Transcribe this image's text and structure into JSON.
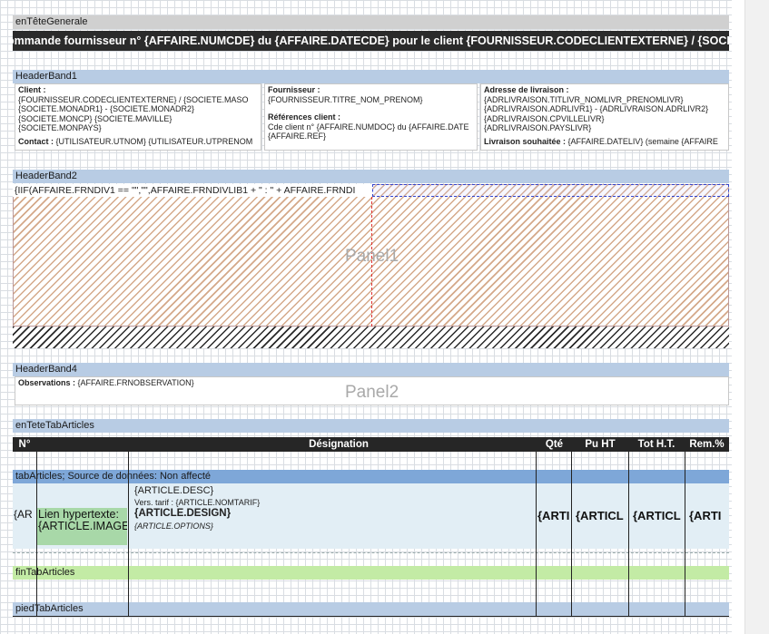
{
  "bands": {
    "entete_generale": "enTêteGenerale",
    "header_band1": "HeaderBand1",
    "header_band2": "HeaderBand2",
    "header_band4": "HeaderBand4",
    "entete_tab_articles": "enTeteTabArticles",
    "tab_articles": "tabArticles; Source de données: Non affecté",
    "fin_tab_articles": "finTabArticles",
    "pied_tab_articles": "piedTabArticles"
  },
  "title_line": "ommande fournisseur n° {AFFAIRE.NUMCDE} du {AFFAIRE.DATECDE} pour le client {FOURNISSEUR.CODECLIENTEXTERNE} / {SOCIETE",
  "client_box": {
    "label": "Client :",
    "lines": [
      "{FOURNISSEUR.CODECLIENTEXTERNE} / {SOCIETE.MASO",
      "{SOCIETE.MONADR1} - {SOCIETE.MONADR2}",
      "{SOCIETE.MONCP} {SOCIETE.MAVILLE}",
      "{SOCIETE.MONPAYS}"
    ],
    "contact_label": "Contact :",
    "contact_value": "{UTILISATEUR.UTNOM} {UTILISATEUR.UTPRENOM"
  },
  "fournisseur_box": {
    "label": "Fournisseur :",
    "value": "{FOURNISSEUR.TITRE_NOM_PRENOM}",
    "ref_label": "Références client :",
    "ref_line1": "Cde client n° {AFFAIRE.NUMDOC} du {AFFAIRE.DATE",
    "ref_line2": "{AFFAIRE.REF}"
  },
  "livraison_box": {
    "label": "Adresse de livraison :",
    "lines": [
      "{ADRLIVRAISON.TITLIVR_NOMLIVR_PRENOMLIVR}",
      "{ADRLIVRAISON.ADRLIVR1} - {ADRLIVRAISON.ADRLIVR2}",
      "{ADRLIVRAISON.CPVILLELIVR}",
      "{ADRLIVRAISON.PAYSLIVR}"
    ],
    "souhaitee_label": "Livraison souhaitée :",
    "souhaitee_value": "{AFFAIRE.DATELIV} (semaine {AFFAIRE"
  },
  "header_band2_expr": "{IIF(AFFAIRE.FRNDIV1 == \"\",\"\",AFFAIRE.FRNDIVLIB1 + \" : \" + AFFAIRE.FRNDI",
  "panel1_label": "Panel1",
  "panel2_label": "Panel2",
  "observations_label": "Observations :",
  "observations_value": "{AFFAIRE.FRNOBSERVATION}",
  "table_headers": [
    "N°",
    "Désignation",
    "Qté",
    "Pu HT",
    "Tot H.T.",
    "Rem.%"
  ],
  "row": {
    "num": "{AR",
    "link_text": "Lien hypertexte: {ARTICLE.IMAGE}",
    "desc": "{ARTICLE.DESC}",
    "tarif": "Vers. tarif : {ARTICLE.NOMTARIF}",
    "design": "{ARTICLE.DESIGN}",
    "options": "{ARTICLE.OPTIONS}",
    "qte": "{ARTI",
    "pu": "{ARTICL",
    "tot": "{ARTICL",
    "rem": "{ARTI"
  },
  "colors": {
    "band": "#b8cce4",
    "band_grey": "#d0d0d0",
    "band_data": "#7ea7d8",
    "band_green": "#c3eba5",
    "hatch": "#d4a98a",
    "header_dark": "#262626"
  }
}
